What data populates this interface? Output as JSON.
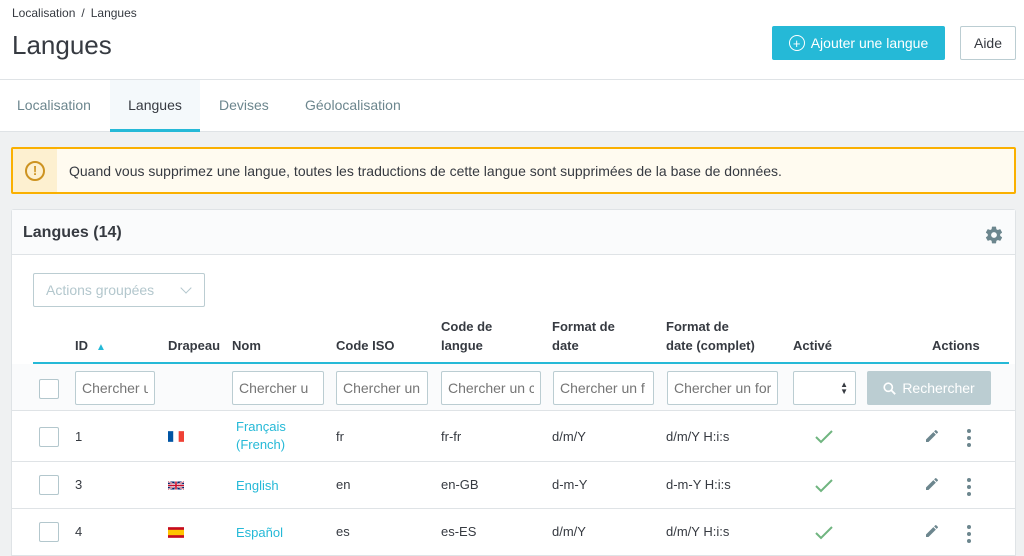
{
  "breadcrumb": {
    "parent": "Localisation",
    "separator": "/",
    "current": "Langues"
  },
  "page": {
    "title": "Langues"
  },
  "toolbar": {
    "add_label": "Ajouter une langue",
    "help_label": "Aide"
  },
  "tabs": [
    {
      "label": "Localisation",
      "active": false
    },
    {
      "label": "Langues",
      "active": true
    },
    {
      "label": "Devises",
      "active": false
    },
    {
      "label": "Géolocalisation",
      "active": false
    }
  ],
  "alert": {
    "icon": "warning-circle-icon",
    "text": "Quand vous supprimez une langue, toutes les traductions de cette langue sont supprimées de la base de données."
  },
  "grid": {
    "title": "Langues (14)",
    "bulk_actions": "Actions groupées",
    "columns": {
      "id": "ID",
      "flag": "Drapeau",
      "name": "Nom",
      "iso": "Code ISO",
      "lang_code_1": "Code de",
      "lang_code_2": "langue",
      "date_1": "Format de",
      "date_2": "date",
      "datefull_1": "Format de",
      "datefull_2": "date (complet)",
      "active": "Activé",
      "actions": "Actions"
    },
    "filters": {
      "id": "Chercher u",
      "name": "Chercher u",
      "iso": "Chercher un",
      "lang_code": "Chercher un c",
      "date": "Chercher un f",
      "datefull": "Chercher un for",
      "search_label": "Rechercher"
    },
    "rows": [
      {
        "id": "1",
        "flag": "fr",
        "name_1": "Français",
        "name_2": "(French)",
        "iso": "fr",
        "lang_code": "fr-fr",
        "date": "d/m/Y",
        "datefull": "d/m/Y H:i:s",
        "active": true
      },
      {
        "id": "3",
        "flag": "gb",
        "name_1": "English",
        "name_2": "",
        "iso": "en",
        "lang_code": "en-GB",
        "date": "d-m-Y",
        "datefull": "d-m-Y H:i:s",
        "active": true
      },
      {
        "id": "4",
        "flag": "es",
        "name_1": "Español",
        "name_2": "",
        "iso": "es",
        "lang_code": "es-ES",
        "date": "d/m/Y",
        "datefull": "d/m/Y H:i:s",
        "active": true
      }
    ]
  },
  "colors": {
    "accent": "#25b9d7",
    "warning": "#fab000",
    "success": "#70b580",
    "text": "#363a41"
  }
}
